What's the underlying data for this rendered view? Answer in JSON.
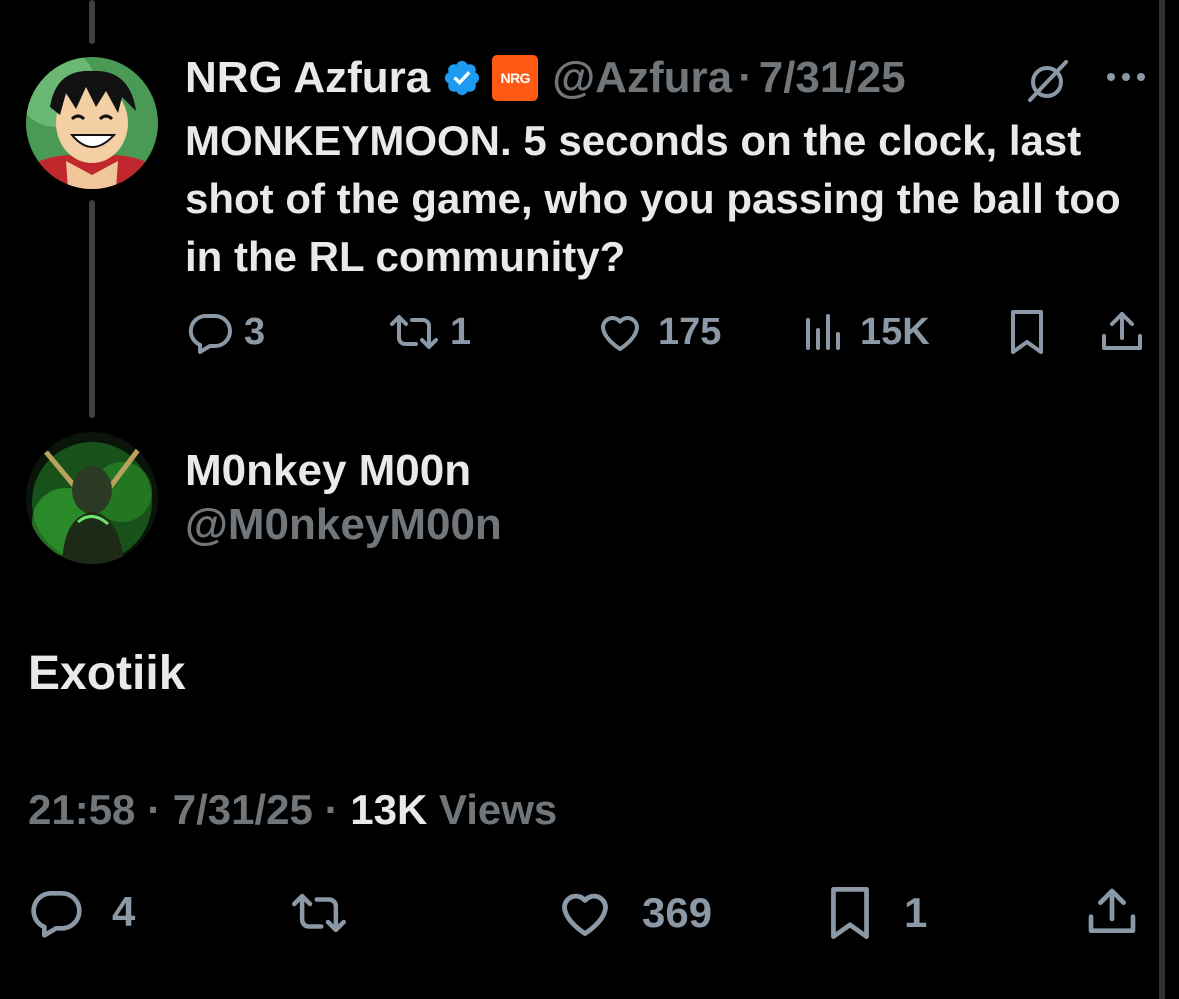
{
  "quoted_tweet": {
    "display_name": "NRG Azfura",
    "org_badge": "NRG",
    "handle": "@Azfura",
    "separator": "·",
    "date": "7/31/25",
    "text": "MONKEYMOON. 5 seconds on the clock, last shot of the game, who you passing the ball too in the RL community?",
    "stats": {
      "replies": "3",
      "reposts": "1",
      "likes": "175",
      "views": "15K"
    },
    "icons": [
      "grok-icon",
      "more-icon",
      "reply-icon",
      "repost-icon",
      "like-icon",
      "views-icon",
      "bookmark-icon",
      "share-icon"
    ]
  },
  "main_tweet": {
    "display_name": "M0nkey M00n",
    "handle": "@M0nkeyM00n",
    "text": "Exotiik",
    "meta": {
      "time": "21:58",
      "separator": "·",
      "date": "7/31/25",
      "views_count": "13K",
      "views_label": "Views"
    },
    "stats": {
      "replies": "4",
      "likes": "369",
      "bookmarks": "1"
    }
  },
  "colors": {
    "background": "#000000",
    "text_primary": "#e7e9ea",
    "text_secondary": "#71767b",
    "verified": "#1d9bf0",
    "nrg_orange": "#ff5a14"
  }
}
